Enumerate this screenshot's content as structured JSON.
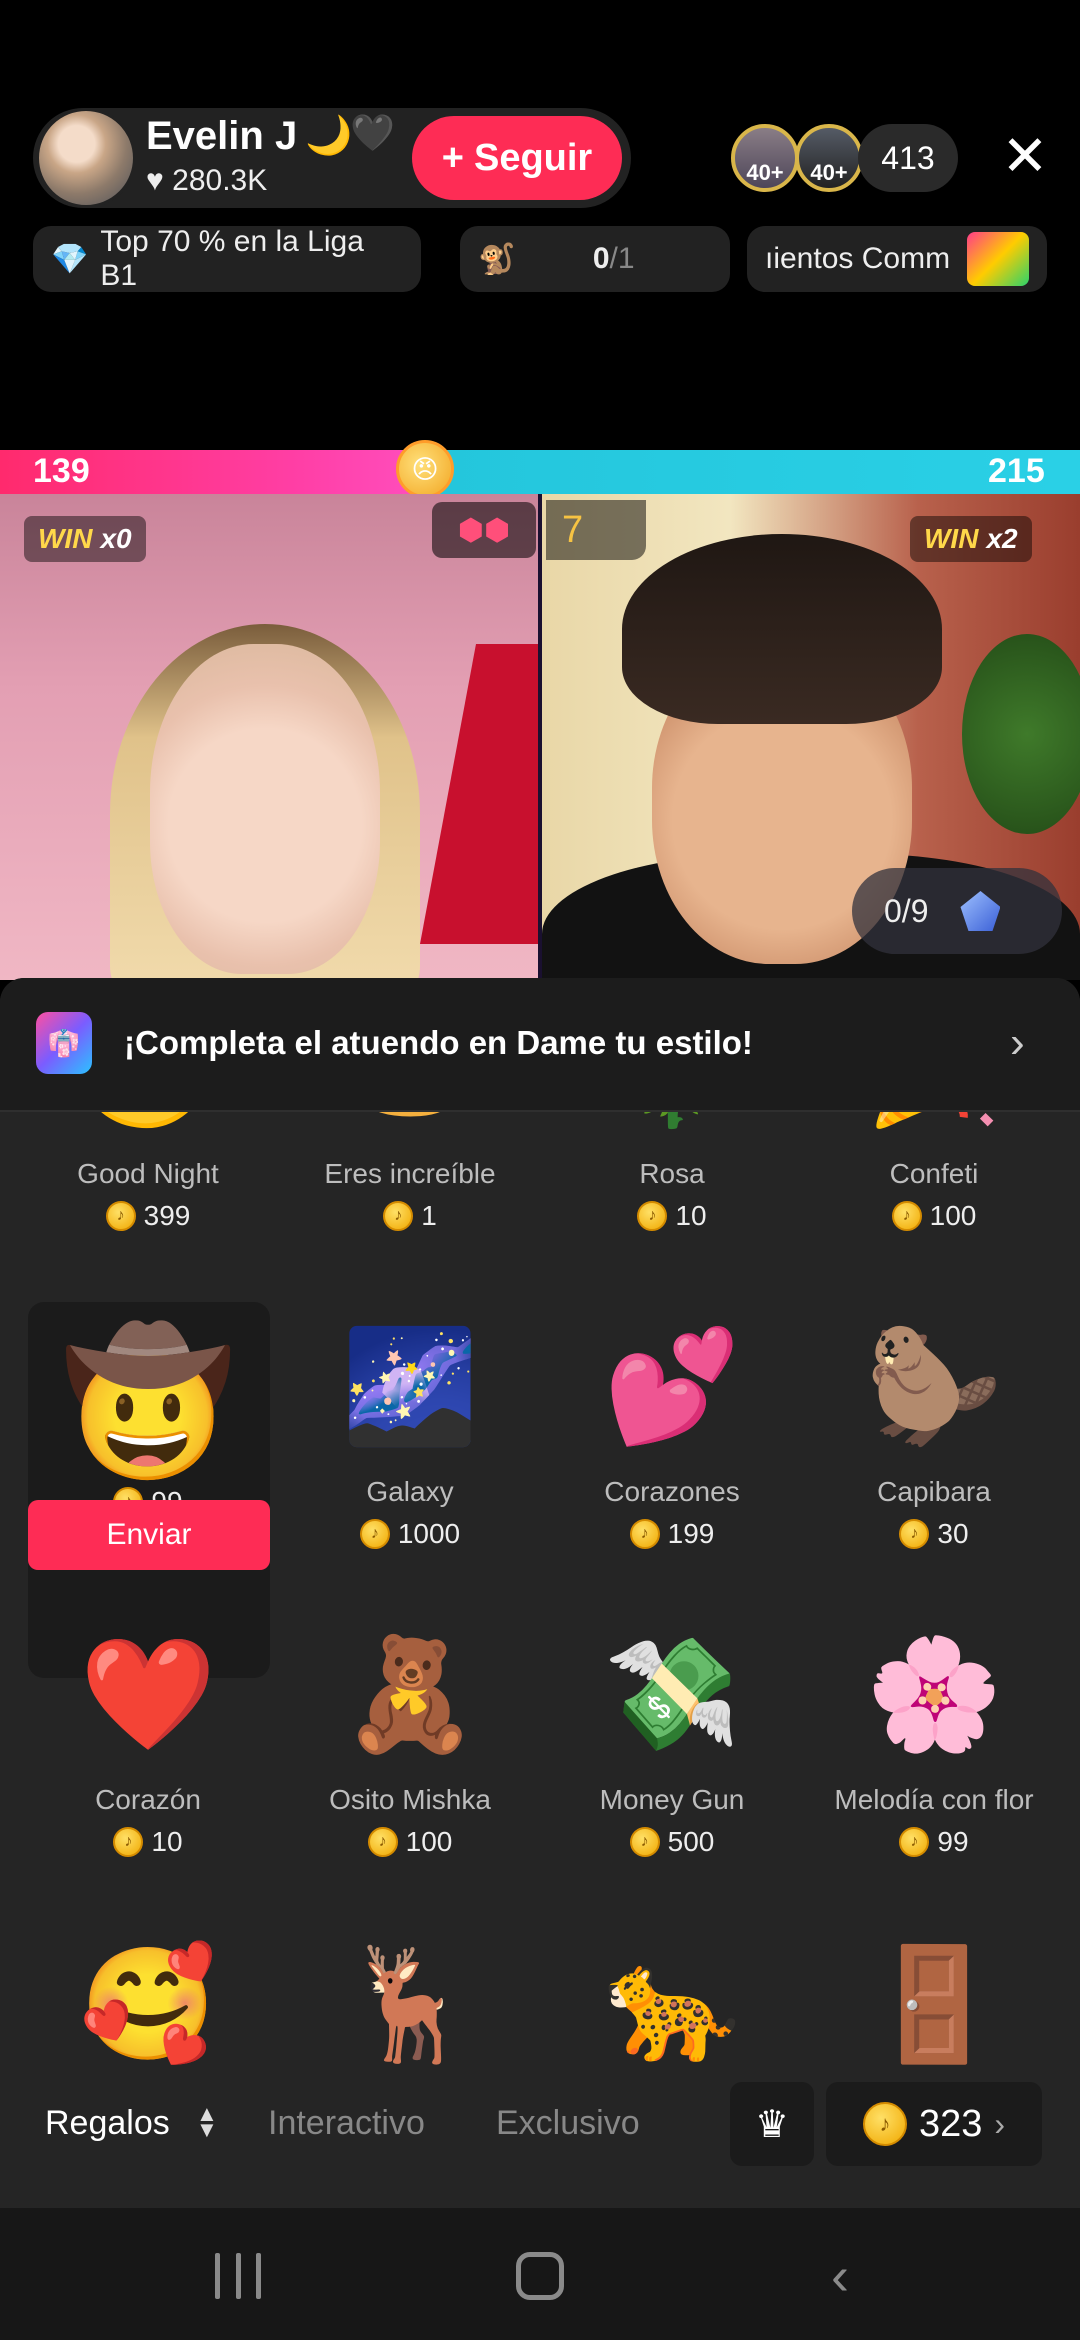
{
  "host": {
    "name": "Evelin J",
    "moon": "🌙",
    "heart_emoji": "🖤",
    "likes": "♥ 280.3K",
    "follow_label": "Seguir",
    "follow_plus": "+"
  },
  "viewers": {
    "badges": [
      "40+",
      "40+"
    ],
    "count": "413",
    "close_icon": "✕"
  },
  "info_bar": {
    "rank_icon": "💎",
    "rank_text": "Top 70 % en la Liga B1",
    "goal_progress_a": "0",
    "goal_progress_b": "/1",
    "event_text": "ıientos Comm"
  },
  "battle": {
    "score_left": "139",
    "score_right": "215",
    "face_emoji": "😠",
    "win_left_label": "WIN",
    "win_left_count": "x0",
    "win_right_label": "WIN",
    "win_right_count": "x2",
    "right_streak": "7",
    "task_progress": "0/9"
  },
  "banner": {
    "icon": "👘",
    "text": "¡Completa el atuendo en Dame tu estilo!",
    "chevron": "›"
  },
  "gifts": [
    {
      "name": "Good Night",
      "price": "399",
      "icon": "🌙"
    },
    {
      "name": "Eres increíble",
      "price": "1",
      "icon": "🍩"
    },
    {
      "name": "Rosa",
      "price": "10",
      "icon": "🌹"
    },
    {
      "name": "Confeti",
      "price": "100",
      "icon": "🎉"
    },
    {
      "name": "",
      "price": "99",
      "icon": "🤠",
      "selected": true,
      "send_label": "Enviar"
    },
    {
      "name": "Galaxy",
      "price": "1000",
      "icon": "🌌"
    },
    {
      "name": "Corazones",
      "price": "199",
      "icon": "💕"
    },
    {
      "name": "Capibara",
      "price": "30",
      "icon": "🦫"
    },
    {
      "name": "Corazón",
      "price": "10",
      "icon": "❤️"
    },
    {
      "name": "Osito Mishka",
      "price": "100",
      "icon": "🧸"
    },
    {
      "name": "Money Gun",
      "price": "500",
      "icon": "💸"
    },
    {
      "name": "Melodía con flor",
      "price": "99",
      "icon": "🌸"
    },
    {
      "name": "",
      "price": "",
      "icon": "🥰"
    },
    {
      "name": "",
      "price": "",
      "icon": "🦌"
    },
    {
      "name": "",
      "price": "",
      "icon": "🐆"
    },
    {
      "name": "",
      "price": "",
      "icon": "🚪"
    }
  ],
  "tabs": {
    "regalos": "Regalos",
    "sort_icon": "⬍",
    "interactivo": "Interactivo",
    "exclusivo": "Exclusivo",
    "crown_icon": "♛",
    "balance": "323",
    "balance_chevron": "›"
  },
  "colors": {
    "accent": "#fe2c55",
    "battle_left": "#ff2a6d",
    "battle_right": "#24c6dc",
    "coin": "#f0a800"
  }
}
